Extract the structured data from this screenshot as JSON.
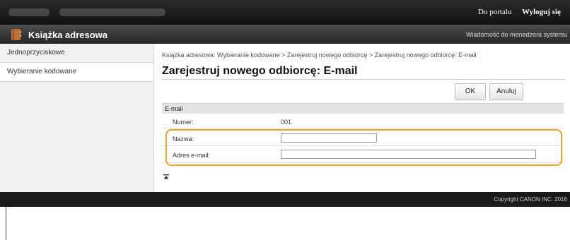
{
  "topbar": {
    "portal_link": "Do portalu",
    "logout_link": "Wyloguj się"
  },
  "app": {
    "title": "Książka adresowa",
    "admin_message": "Wiadomość do menedżera systemu"
  },
  "sidebar": {
    "items": [
      {
        "label": "Jednoprzyciskowe",
        "active": false
      },
      {
        "label": "Wybieranie kodowane",
        "active": true
      }
    ]
  },
  "main": {
    "breadcrumb": "Książka adresowa: Wybieranie kodowane > Zarejestruj nowego odbiorcę > Zarejestruj nowego odbiorcę: E-mail",
    "page_title": "Zarejestruj nowego odbiorcę: E-mail",
    "ok_label": "OK",
    "cancel_label": "Anuluj",
    "section_title": "E-mail",
    "number_label": "Numer:",
    "number_value": "001",
    "name_label": "Nazwa:",
    "name_value": "",
    "email_label": "Adres e-mail:",
    "email_value": ""
  },
  "footer": {
    "copyright": "Copyright CANON INC. 2016"
  },
  "colors": {
    "highlight": "#f2a31f",
    "app_icon": "#c0703a"
  },
  "icons": {
    "app": "address-book-icon",
    "back_to_top": "back-to-top-icon"
  }
}
